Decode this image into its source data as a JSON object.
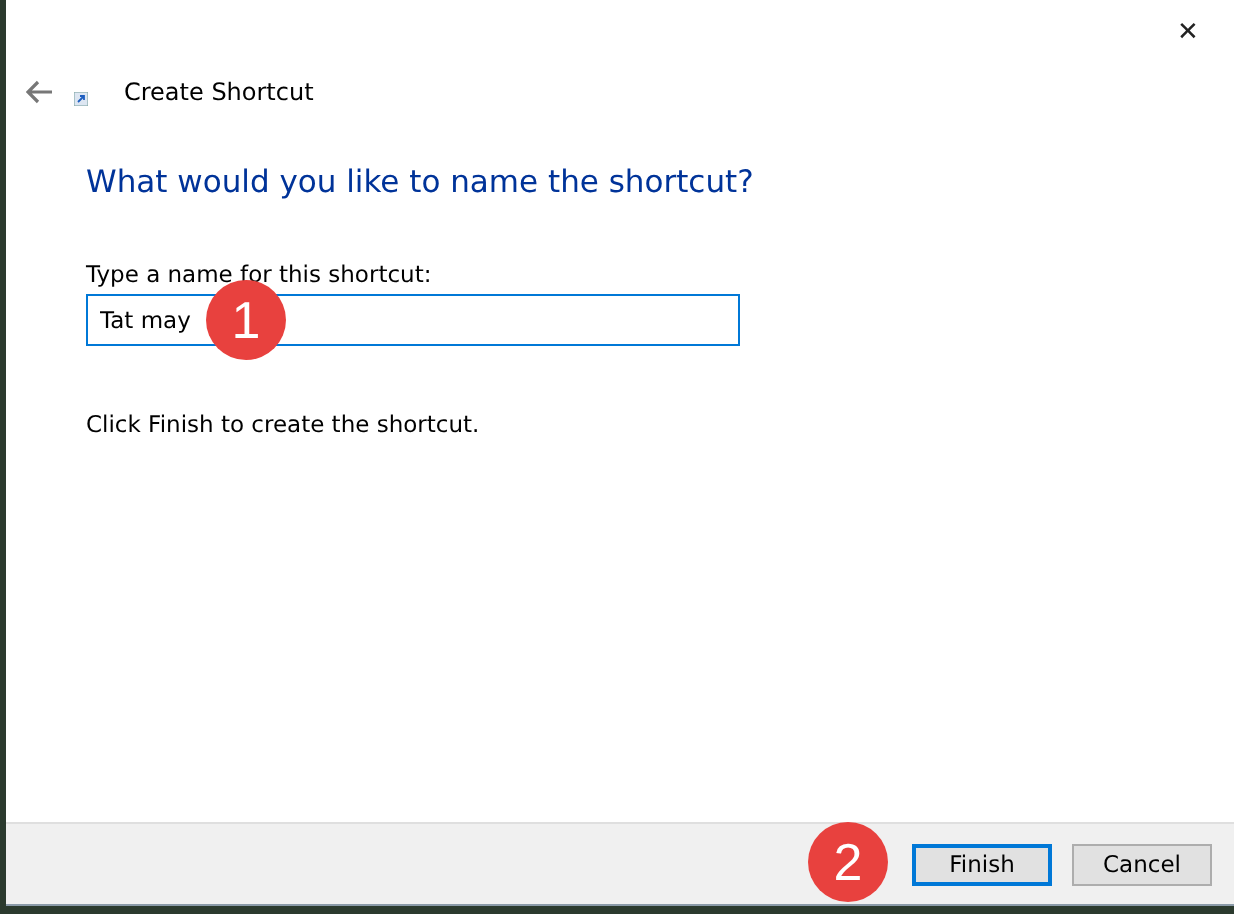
{
  "window": {
    "close": "✕",
    "title": "Create Shortcut"
  },
  "heading": "What would you like to name the shortcut?",
  "name_field": {
    "label": "Type a name for this shortcut:",
    "value": "Tat may",
    "step_marker": "1"
  },
  "instruction": "Click Finish to create the shortcut.",
  "buttons": [
    {
      "label": "Finish",
      "default": true,
      "step_marker": "2"
    },
    {
      "label": "Cancel",
      "default": false
    }
  ]
}
